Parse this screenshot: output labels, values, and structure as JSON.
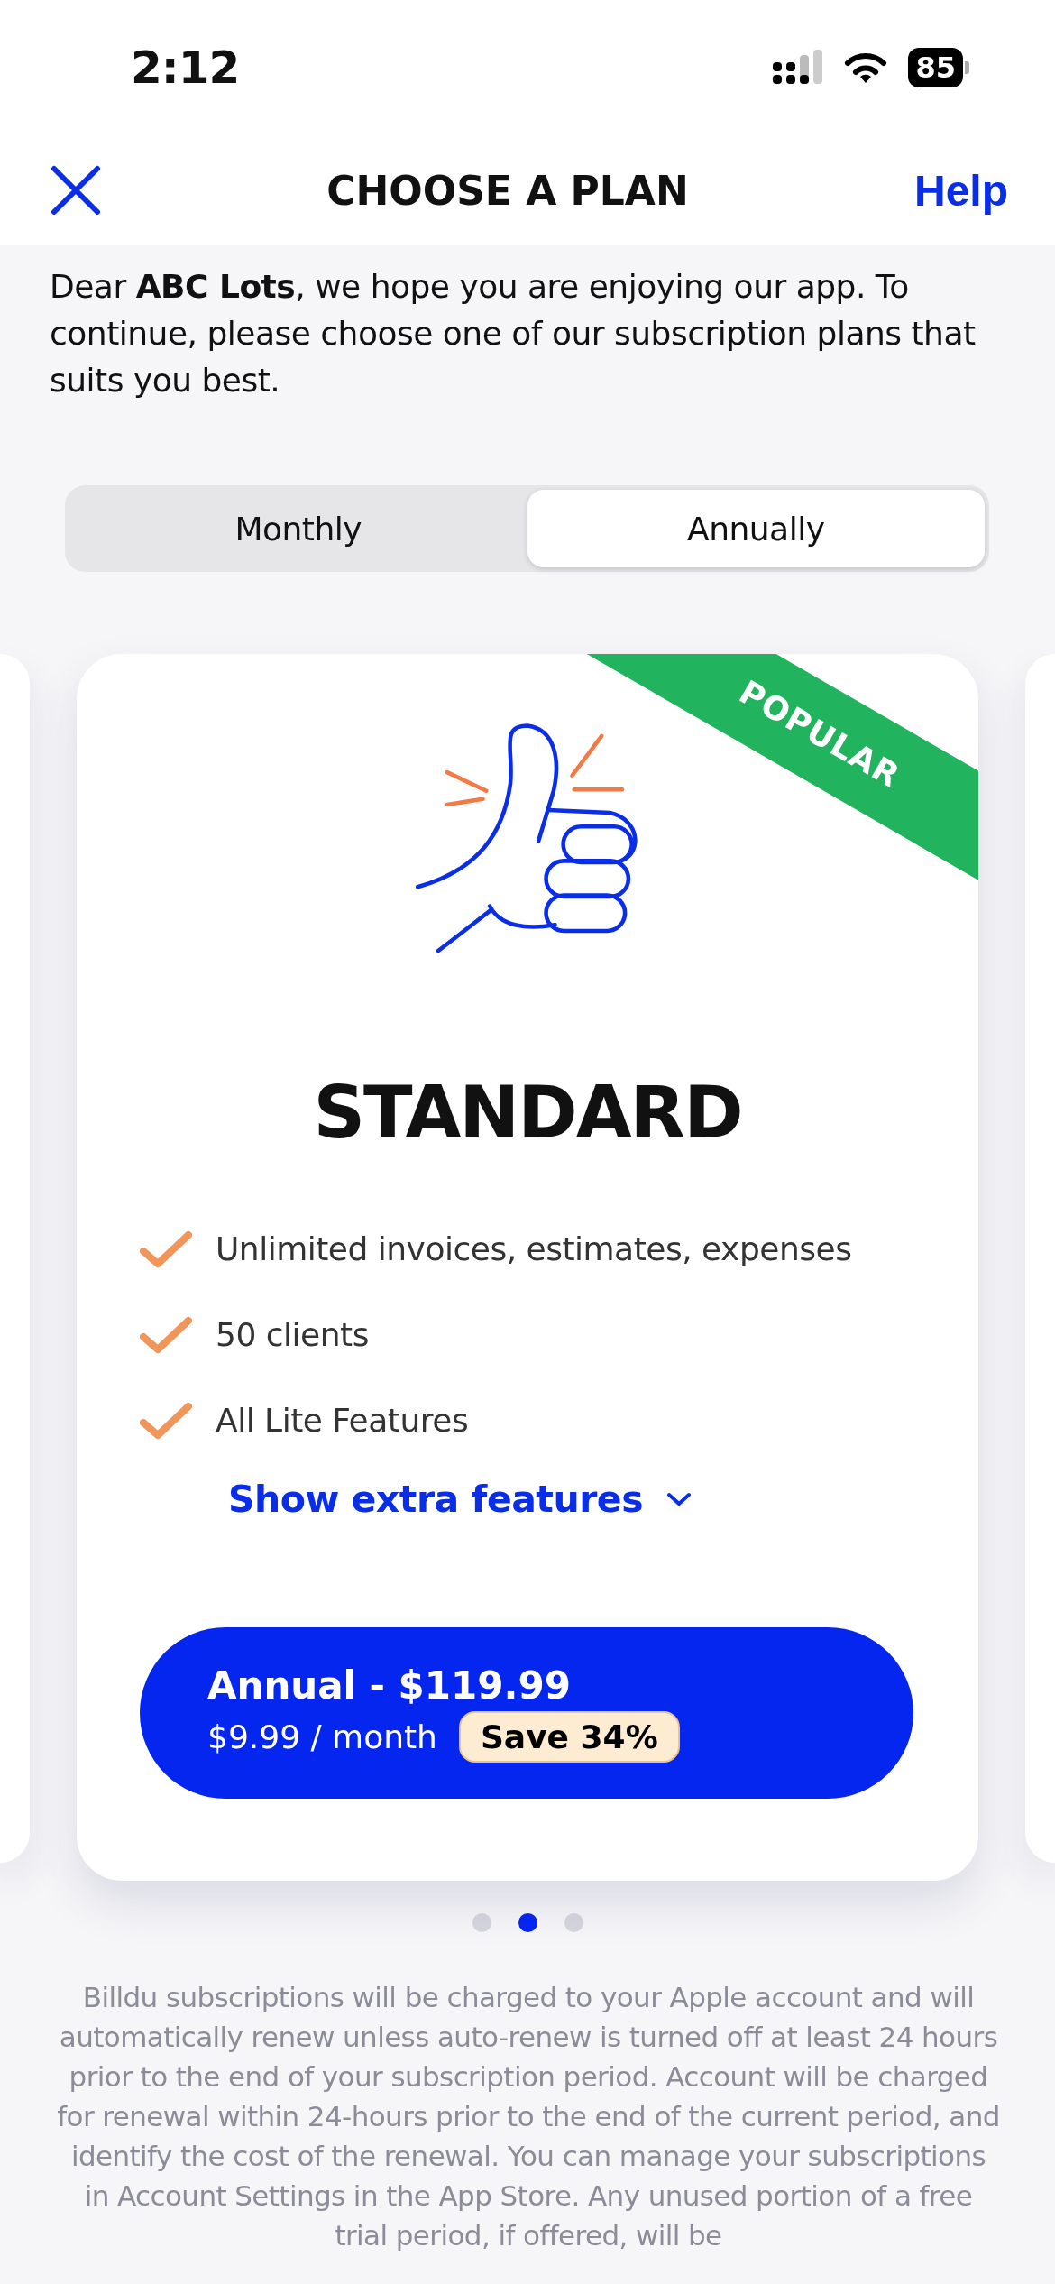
{
  "status_bar": {
    "time": "2:12",
    "battery": "85"
  },
  "nav": {
    "title": "CHOOSE A PLAN",
    "help": "Help"
  },
  "greeting": "Dear **ABC Lots**, we hope you are enjoying our app. To continue, please choose one of our subscription plans that suits you best.",
  "billing_tabs": [
    {
      "label": "Monthly",
      "selected": false
    },
    {
      "label": "Annually",
      "selected": true
    }
  ],
  "plan": {
    "badge": "POPULAR",
    "name": "STANDARD",
    "features": [
      "Unlimited invoices, estimates, expenses",
      "50 clients",
      "All Lite Features"
    ],
    "extra_link": "Show extra features",
    "price": "Annual - $119.99",
    "monthly": "$9.99 / month",
    "savings": "Save 34%"
  },
  "pager": [
    {
      "selected": false
    },
    {
      "selected": true
    },
    {
      "selected": false
    }
  ],
  "legal": "Billdu subscriptions will be charged to your Apple account and will automatically renew unless auto-renew is turned off at least 24 hours prior to the end of your subscription period. Account will be charged for renewal within 24-hours prior to the end of the current period, and identify the cost of the renewal. You can manage your subscriptions in Account Settings in the App Store. Any unused portion of a free trial period, if offered, will be"
}
